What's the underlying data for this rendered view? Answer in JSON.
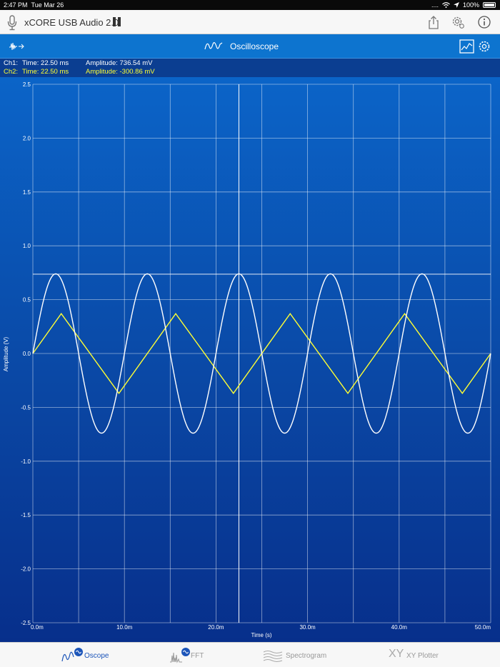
{
  "status_bar": {
    "time": "2:47 PM",
    "date": "Tue Mar 26",
    "signal": "....",
    "battery": "100%"
  },
  "nav_bar": {
    "title": "xCORE USB Audio 2.0"
  },
  "scope_header": {
    "title": "Oscilloscope"
  },
  "readout": {
    "ch1": {
      "label": "Ch1:",
      "time": "Time: 22.50 ms",
      "amplitude": "Amplitude: 736.54 mV",
      "color": "#ffffff"
    },
    "ch2": {
      "label": "Ch2:",
      "time": "Time: 22.50 ms",
      "amplitude": "Amplitude: -300.86 mV",
      "color": "#ffff33"
    }
  },
  "tabs": [
    {
      "label": "Oscope",
      "active": true
    },
    {
      "label": "FFT",
      "active": false
    },
    {
      "label": "Spectrogram",
      "active": false
    },
    {
      "label": "XY Plotter",
      "active": false
    }
  ],
  "colors": {
    "accent": "#0d74cf",
    "tab_active": "#1c55b9",
    "ch1": "#ffffff",
    "ch2": "#ffff33"
  },
  "chart_data": {
    "type": "line",
    "xlabel": "Time (s)",
    "ylabel": "Amplitude (V)",
    "xlim": [
      0,
      0.05
    ],
    "ylim": [
      -2.5,
      2.5
    ],
    "x_ticks": [
      "0.0m",
      "10.0m",
      "20.0m",
      "30.0m",
      "40.0m",
      "50.0m"
    ],
    "y_ticks": [
      "2.5",
      "2.0",
      "1.5",
      "1.0",
      "0.5",
      "0.0",
      "-0.5",
      "-1.0",
      "-1.5",
      "-2.0",
      "-2.5"
    ],
    "grid": true,
    "cursor": {
      "time": 0.0225,
      "ch1_amplitude": 0.73654,
      "ch2_amplitude": -0.30086
    },
    "series": [
      {
        "name": "Ch1",
        "waveform": "sine",
        "amplitude": 0.74,
        "period": 0.01,
        "color": "#ffffff",
        "peaks": [
          [
            0.0025,
            0.74
          ],
          [
            0.0125,
            0.74
          ],
          [
            0.0225,
            0.74
          ],
          [
            0.0325,
            0.74
          ],
          [
            0.0425,
            0.74
          ]
        ],
        "troughs": [
          [
            0.0075,
            -0.74
          ],
          [
            0.0175,
            -0.74
          ],
          [
            0.0275,
            -0.74
          ],
          [
            0.0375,
            -0.74
          ],
          [
            0.0475,
            -0.74
          ]
        ]
      },
      {
        "name": "Ch2",
        "waveform": "triangle",
        "color": "#ffff33",
        "x": [
          0,
          0.0031,
          0.0094,
          0.0156,
          0.0219,
          0.0281,
          0.0344,
          0.0406,
          0.0469,
          0.05
        ],
        "y": [
          0,
          0.37,
          -0.37,
          0.37,
          -0.37,
          0.37,
          -0.37,
          0.37,
          -0.37,
          0
        ]
      }
    ]
  }
}
